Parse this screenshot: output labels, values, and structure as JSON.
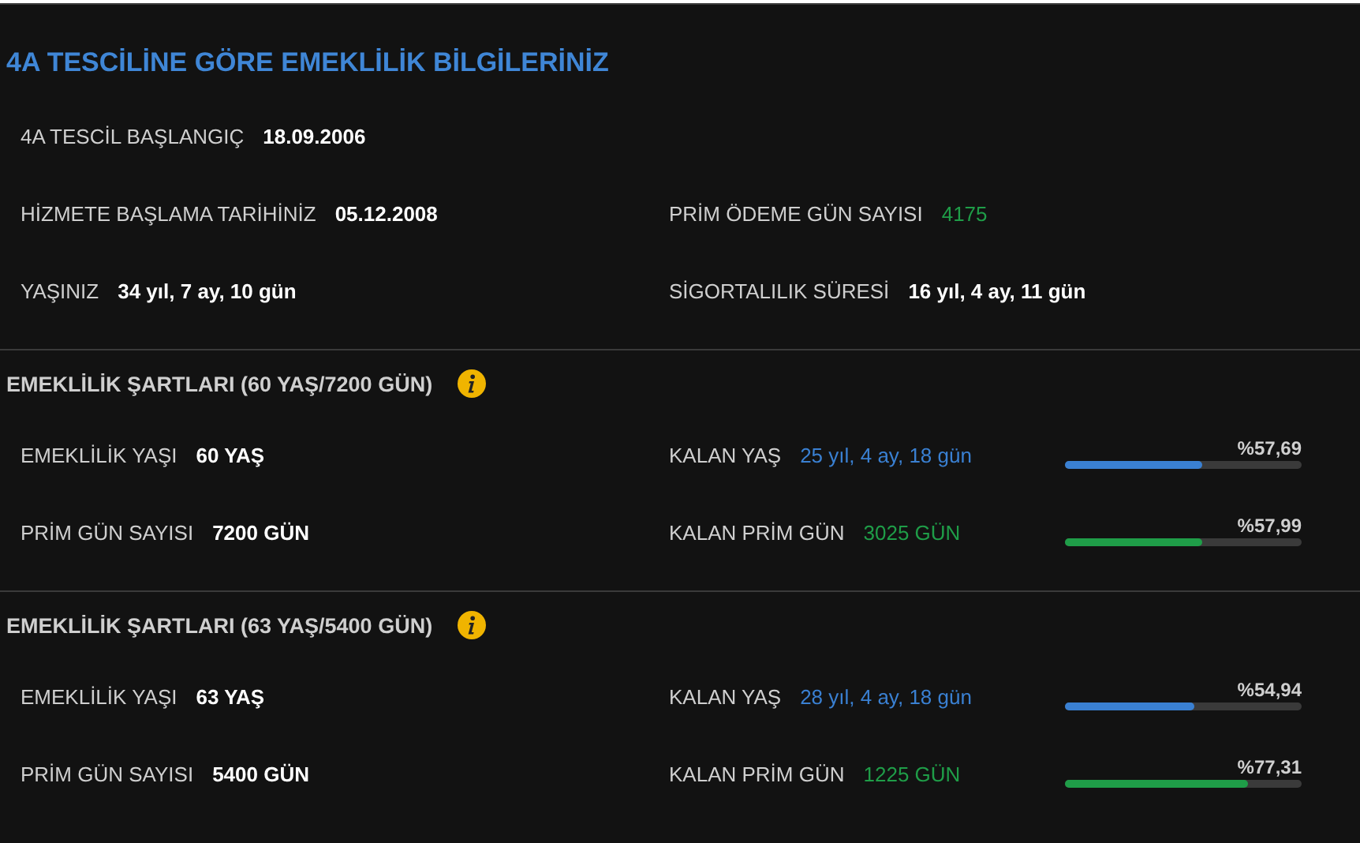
{
  "title": "4A TESCİLİNE GÖRE EMEKLİLİK BİLGİLERİNİZ",
  "info_rows": [
    [
      {
        "label": "4A TESCİL BAŞLANGIÇ",
        "value": "18.09.2006"
      }
    ],
    [
      {
        "label": "HİZMETE BAŞLAMA TARİHİNİZ",
        "value": "05.12.2008"
      },
      {
        "label": "PRİM ÖDEME GÜN SAYISI",
        "value": "4175",
        "color": "#1f9d48"
      }
    ],
    [
      {
        "label": "YAŞINIZ",
        "value": "34 yıl, 7 ay, 10 gün"
      },
      {
        "label": "SİGORTALILIK SÜRESİ",
        "value": "16 yıl, 4 ay, 11 gün"
      }
    ]
  ],
  "sections": [
    {
      "title": "EMEKLİLİK ŞARTLARI (60 YAŞ/7200 GÜN)",
      "rows": [
        {
          "label": "EMEKLİLİK YAŞI",
          "value": "60 YAŞ",
          "remaining": {
            "label": "KALAN YAŞ",
            "value": "25 yıl, 4 ay, 18 gün",
            "color": "#3a80d2",
            "level": 0.5769,
            "reading": "%57,69"
          }
        },
        {
          "label": "PRİM GÜN SAYISI",
          "value": "7200 GÜN",
          "remaining": {
            "label": "KALAN PRİM GÜN",
            "value": "3025 GÜN",
            "color": "#1f9d48",
            "level": 0.5799,
            "reading": "%57,99"
          }
        }
      ]
    },
    {
      "title": "EMEKLİLİK ŞARTLARI (63 YAŞ/5400 GÜN)",
      "rows": [
        {
          "label": "EMEKLİLİK YAŞI",
          "value": "63 YAŞ",
          "remaining": {
            "label": "KALAN YAŞ",
            "value": "28 yıl, 4 ay, 18 gün",
            "color": "#3a80d2",
            "level": 0.5494,
            "reading": "%54,94"
          }
        },
        {
          "label": "PRİM GÜN SAYISI",
          "value": "5400 GÜN",
          "remaining": {
            "label": "KALAN PRİM GÜN",
            "value": "1225 GÜN",
            "color": "#1f9d48",
            "level": 0.7731,
            "reading": "%77,31"
          }
        }
      ]
    }
  ]
}
